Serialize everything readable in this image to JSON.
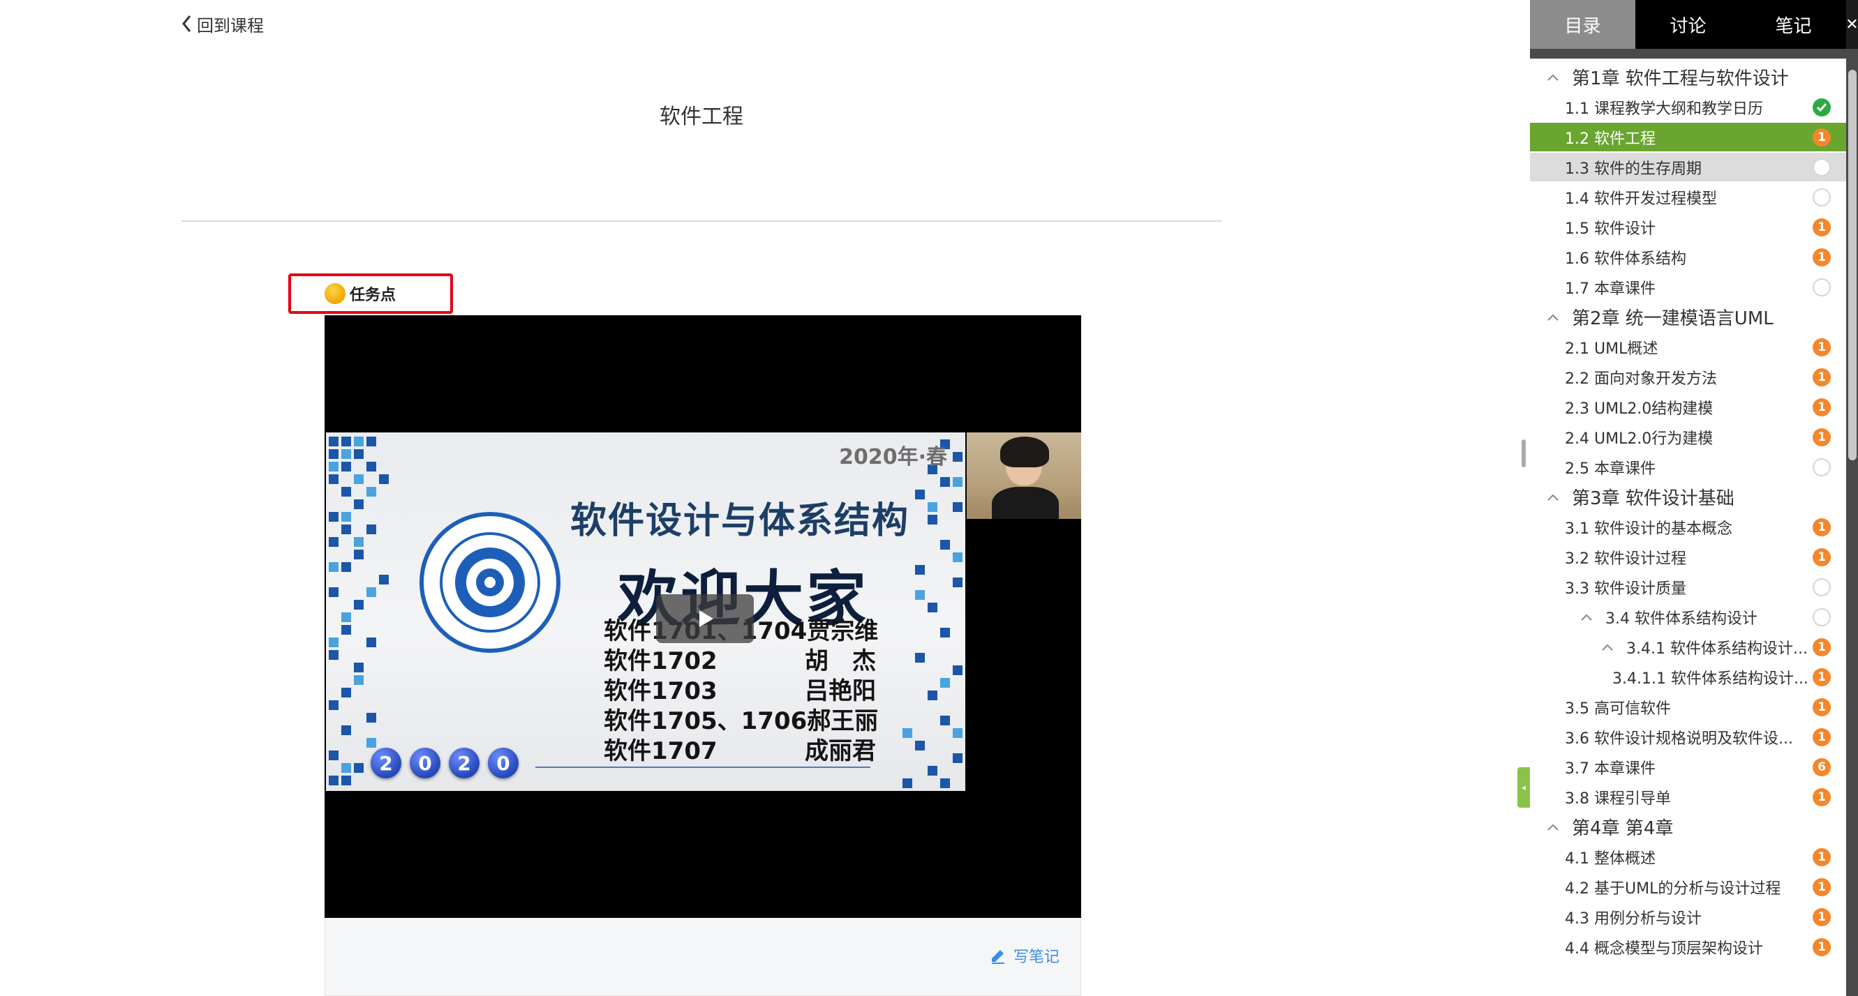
{
  "nav": {
    "back_label": "回到课程"
  },
  "page": {
    "title": "软件工程"
  },
  "task_point": {
    "label": "任务点"
  },
  "video": {
    "slide": {
      "year": "2020年·春",
      "title": "软件设计与体系结构",
      "welcome": "欢迎大家",
      "lines": [
        {
          "class": "软件1701、1704",
          "teacher": "贾宗维"
        },
        {
          "class": "软件1702",
          "teacher": "胡　杰"
        },
        {
          "class": "软件1703",
          "teacher": "吕艳阳"
        },
        {
          "class": "软件1705、1706",
          "teacher": "郝王丽"
        },
        {
          "class": "软件1707",
          "teacher": "成丽君"
        }
      ],
      "year_balls": [
        "2",
        "0",
        "2",
        "0"
      ]
    },
    "write_note_label": "写笔记"
  },
  "sidebar": {
    "tabs": [
      {
        "label": "目录"
      },
      {
        "label": "讨论"
      },
      {
        "label": "笔记"
      }
    ],
    "items": [
      {
        "text": "第1章 软件工程与软件设计",
        "kind": "chapter",
        "indent": 0,
        "chevron": true
      },
      {
        "text": "1.1 课程教学大纲和教学日历",
        "kind": "item",
        "indent": 1,
        "status": "done"
      },
      {
        "text": "1.2 软件工程",
        "kind": "item",
        "indent": 1,
        "status": "task",
        "count": "1",
        "state": "active"
      },
      {
        "text": "1.3 软件的生存周期",
        "kind": "item",
        "indent": 1,
        "status": "none",
        "state": "hover"
      },
      {
        "text": "1.4 软件开发过程模型",
        "kind": "item",
        "indent": 1,
        "status": "none"
      },
      {
        "text": "1.5 软件设计",
        "kind": "item",
        "indent": 1,
        "status": "task",
        "count": "1"
      },
      {
        "text": "1.6 软件体系结构",
        "kind": "item",
        "indent": 1,
        "status": "task",
        "count": "1"
      },
      {
        "text": "1.7 本章课件",
        "kind": "item",
        "indent": 1,
        "status": "none"
      },
      {
        "text": "第2章 统一建模语言UML",
        "kind": "chapter",
        "indent": 0,
        "chevron": true
      },
      {
        "text": "2.1 UML概述",
        "kind": "item",
        "indent": 1,
        "status": "task",
        "count": "1"
      },
      {
        "text": "2.2 面向对象开发方法",
        "kind": "item",
        "indent": 1,
        "status": "task",
        "count": "1"
      },
      {
        "text": "2.3 UML2.0结构建模",
        "kind": "item",
        "indent": 1,
        "status": "task",
        "count": "1"
      },
      {
        "text": "2.4 UML2.0行为建模",
        "kind": "item",
        "indent": 1,
        "status": "task",
        "count": "1"
      },
      {
        "text": "2.5 本章课件",
        "kind": "item",
        "indent": 1,
        "status": "none"
      },
      {
        "text": "第3章 软件设计基础",
        "kind": "chapter",
        "indent": 0,
        "chevron": true
      },
      {
        "text": "3.1 软件设计的基本概念",
        "kind": "item",
        "indent": 1,
        "status": "task",
        "count": "1"
      },
      {
        "text": "3.2 软件设计过程",
        "kind": "item",
        "indent": 1,
        "status": "task",
        "count": "1"
      },
      {
        "text": "3.3 软件设计质量",
        "kind": "item",
        "indent": 1,
        "status": "none"
      },
      {
        "text": "3.4 软件体系结构设计",
        "kind": "item",
        "indent": 2,
        "status": "none",
        "chevron": true
      },
      {
        "text": "3.4.1 软件体系结构设计...",
        "kind": "item",
        "indent": 3,
        "status": "task",
        "count": "1",
        "chevron": true
      },
      {
        "text": "3.4.1.1 软件体系结构设计...",
        "kind": "item",
        "indent": 4,
        "status": "task",
        "count": "1"
      },
      {
        "text": "3.5 高可信软件",
        "kind": "item",
        "indent": 1,
        "status": "task",
        "count": "1"
      },
      {
        "text": "3.6 软件设计规格说明及软件设...",
        "kind": "item",
        "indent": 1,
        "status": "task",
        "count": "1"
      },
      {
        "text": "3.7 本章课件",
        "kind": "item",
        "indent": 1,
        "status": "task",
        "count": "6"
      },
      {
        "text": "3.8 课程引导单",
        "kind": "item",
        "indent": 1,
        "status": "task",
        "count": "1"
      },
      {
        "text": "第4章 第4章",
        "kind": "chapter",
        "indent": 0,
        "chevron": true
      },
      {
        "text": "4.1 整体概述",
        "kind": "item",
        "indent": 1,
        "status": "task",
        "count": "1"
      },
      {
        "text": "4.2 基于UML的分析与设计过程",
        "kind": "item",
        "indent": 1,
        "status": "task",
        "count": "1"
      },
      {
        "text": "4.3 用例分析与设计",
        "kind": "item",
        "indent": 1,
        "status": "task",
        "count": "1"
      },
      {
        "text": "4.4 概念模型与顶层架构设计",
        "kind": "item",
        "indent": 1,
        "status": "task",
        "count": "1"
      }
    ]
  },
  "colors": {
    "active_item": "#6aa530",
    "task_badge": "#f5862a",
    "done_badge": "#2eaa43",
    "task_box_border": "#e60012",
    "note_link": "#3a8ee6"
  },
  "icons": {
    "back": "chevron-left-icon",
    "task": "task-dot-icon",
    "play": "play-icon",
    "note": "pencil-icon",
    "chapter": "chevron-up-icon",
    "done": "check-circle-icon"
  }
}
